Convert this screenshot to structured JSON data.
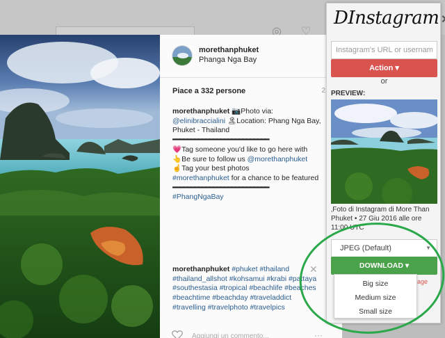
{
  "post": {
    "username": "morethanphuket",
    "location": "Phanga Nga Bay",
    "likes": "Piace a 332 persone",
    "time": "21 h",
    "caption": {
      "user": "morethanphuket",
      "line_photo": "📷Photo via:",
      "mention1": "@elinibraccialini",
      "location_text": "🏝Location: Phang Nga Bay, Phuket - Thailand",
      "separator": "━━━━━━━━━━━━━━━━━━━━━━━━━━",
      "tag_line": "💗Tag someone you'd like to go here with",
      "follow_prefix": "👆Be sure to follow us ",
      "follow_mention": "@morethanphuket",
      "best_photos": "☝Tag your best photos",
      "hashtag_main": "#morethanphuket",
      "best_photos_suffix": " for a chance to be featured",
      "hashtag_bay": "#PhangNgaBay"
    },
    "comment2": {
      "user": "morethanphuket",
      "tags": [
        "#phuket",
        "#thailand",
        "#thailand_allshot",
        "#kohsamui",
        "#krabi",
        "#pattaya",
        "#southestasia",
        "#tropical",
        "#beachlife",
        "#beaches",
        "#beachtime",
        "#beachday",
        "#traveladdict",
        "#travelling",
        "#travelphoto",
        "#travelpics"
      ]
    },
    "add_comment": "Aggiungi un commento...",
    "more": "···",
    "close_glyph": "✕"
  },
  "popup": {
    "logo": "DInstagram",
    "close_glyph": "✕",
    "url_placeholder": "Instagram's URL or username",
    "action_label": "Action ▾",
    "or_label": "or",
    "preview_label": "PREVIEW:",
    "preview_caption": "‚Foto di Instagram di More Than Phuket • 27 Giu 2016 alle ore 11:00 UTC",
    "format_value": "JPEG (Default)",
    "download_label": "DOWNLOAD ▾",
    "size_options": [
      "Big size",
      "Medium size",
      "Small size"
    ],
    "image_peek": "age"
  },
  "colors": {
    "action": "#d9534f",
    "download": "#4aa24a",
    "link": "#2a5d8f",
    "annotation": "#2aa84a"
  }
}
